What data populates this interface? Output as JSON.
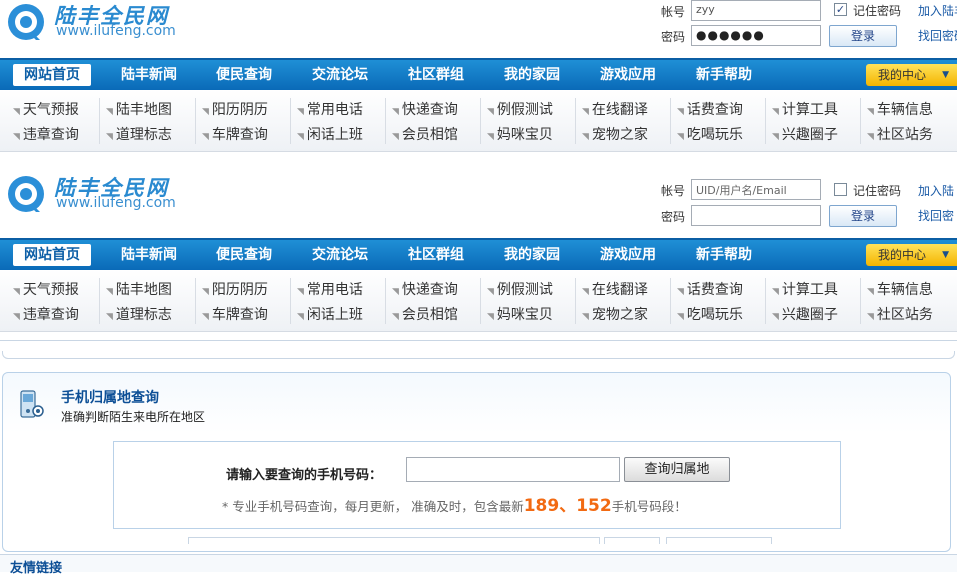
{
  "logo": {
    "title": "陆丰全民网",
    "url": "www.ilufeng.com"
  },
  "login_a": {
    "account_label": "帐号",
    "account_value": "zyy",
    "password_label": "密码",
    "password_value": "●●●●●●",
    "remember_label": "记住密码",
    "remember_mark": "✓",
    "login_button": "登录",
    "join_link": "加入陆丰",
    "recover_link": "找回密码"
  },
  "login_b": {
    "account_label": "帐号",
    "account_placeholder": "UID/用户名/Email",
    "password_label": "密码",
    "password_value": "",
    "remember_label": "记住密码",
    "remember_mark": "",
    "login_button": "登录",
    "join_link": "加入陆",
    "recover_link": "找回密"
  },
  "nav": [
    "网站首页",
    "陆丰新闻",
    "便民查询",
    "交流论坛",
    "社区群组",
    "我的家园",
    "游戏应用",
    "新手帮助"
  ],
  "my_center": "我的中心",
  "my_center_arrow": "▼",
  "subnav_row1": [
    "天气预报",
    "陆丰地图",
    "阳历阴历",
    "常用电话",
    "快递查询",
    "例假测试",
    "在线翻译",
    "话费查询",
    "计算工具",
    "车辆信息"
  ],
  "subnav_row2": [
    "违章查询",
    "道理标志",
    "车牌查询",
    "闲话上班",
    "会员相馆",
    "妈咪宝贝",
    "宠物之家",
    "吃喝玩乐",
    "兴趣圈子",
    "社区站务"
  ],
  "panel": {
    "title": "手机归属地查询",
    "subtitle": "准确判断陌生来电所在地区",
    "query_label": "请输入要查询的手机号码：",
    "query_value": "",
    "query_button": "查询归属地",
    "note_prefix": "* 专业手机号码查询，每月更新，  准确及时，包含最新",
    "note_highlight": "189、152",
    "note_suffix": "手机号码段！"
  },
  "friend_links": "友情链接",
  "colors": {
    "nav_blue": "#0a6ab8",
    "accent_orange": "#f26a12",
    "my_center_yellow": "#f4b400",
    "title_blue": "#0d4f96"
  }
}
